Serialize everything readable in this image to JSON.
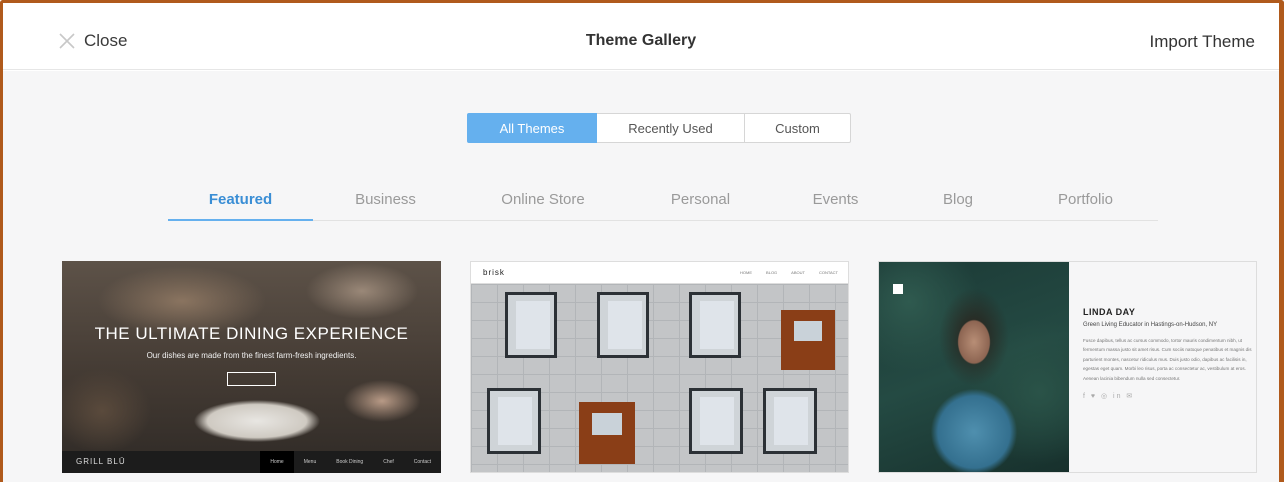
{
  "header": {
    "close_label": "Close",
    "title": "Theme Gallery",
    "import_label": "Import Theme"
  },
  "filter_tabs": [
    {
      "label": "All Themes",
      "active": true
    },
    {
      "label": "Recently Used",
      "active": false
    },
    {
      "label": "Custom",
      "active": false
    }
  ],
  "categories": [
    {
      "label": "Featured",
      "active": true
    },
    {
      "label": "Business",
      "active": false
    },
    {
      "label": "Online Store",
      "active": false
    },
    {
      "label": "Personal",
      "active": false
    },
    {
      "label": "Events",
      "active": false
    },
    {
      "label": "Blog",
      "active": false
    },
    {
      "label": "Portfolio",
      "active": false
    }
  ],
  "themes": [
    {
      "name": "Grill Blu",
      "headline": "THE ULTIMATE DINING EXPERIENCE",
      "subline": "Our dishes are made from the finest farm-fresh ingredients.",
      "brand": "GRILL BLŪ",
      "nav": [
        "Home",
        "Menu",
        "Book Dining",
        "Chef",
        "Contact"
      ]
    },
    {
      "name": "Brisk",
      "brand": "brisk",
      "nav": [
        "HOME",
        "BLOG",
        "ABOUT",
        "CONTACT"
      ]
    },
    {
      "name": "Linda Day",
      "person_name": "LINDA DAY",
      "tagline": "Green Living Educator in Hastings-on-Hudson, NY",
      "body": "Fusce dapibus, tellus ac cursus commodo, tortor mauris condimentum nibh, ut fermentum massa justo sit amet risus. Cum sociis natoque penatibus et magnis dis parturient montes, nascetur ridiculus mus. Duis justo odio, dapibus ac facilisis in, egestas eget quam. Morbi leo risus, porta ac consectetur ac, vestibulum at eros. Aenean lacinia bibendum nulla sed consectetur.",
      "social": "f ♥ ◎ in ✉"
    }
  ],
  "colors": {
    "accent": "#65b0ee",
    "accent_text": "#3a8ed5",
    "frame_border": "#b05a1c"
  }
}
